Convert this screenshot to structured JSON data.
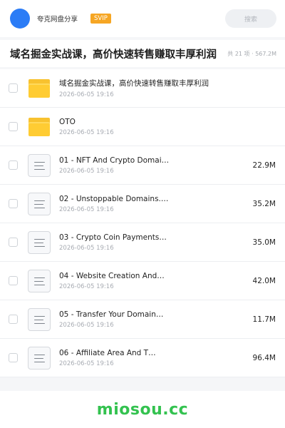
{
  "header": {
    "app_name": "夸克网盘分享",
    "badge": "SVIP",
    "search_label": "搜索",
    "avatar_color": "#2b7cf6",
    "badge_color": "#f6a623"
  },
  "folder": {
    "title": "域名掘金实战课，高价快速转售赚取丰厚利润",
    "summary": "共 21 项 · 567.2M"
  },
  "files": [
    {
      "icon": "folder-icon",
      "name": "域名掘金实战课，高价快速转售赚取丰厚利润",
      "date": "2026-06-05 19:16",
      "size": ""
    },
    {
      "icon": "folder-icon",
      "name": "OTO",
      "date": "2026-06-05 19:16",
      "size": ""
    },
    {
      "icon": "document-icon",
      "name": "01 - NFT And Crypto Domai…",
      "date": "2026-06-05 19:16",
      "size": "22.9M"
    },
    {
      "icon": "document-icon",
      "name": "02 - Unstoppable Domains.…",
      "date": "2026-06-05 19:16",
      "size": "35.2M"
    },
    {
      "icon": "document-icon",
      "name": "03 - Crypto Coin Payments…",
      "date": "2026-06-05 19:16",
      "size": "35.0M"
    },
    {
      "icon": "document-icon",
      "name": "04 - Website Creation And…",
      "date": "2026-06-05 19:16",
      "size": "42.0M"
    },
    {
      "icon": "document-icon",
      "name": "05 - Transfer Your Domain…",
      "date": "2026-06-05 19:16",
      "size": "11.7M"
    },
    {
      "icon": "document-icon",
      "name": "06 - Affiliate Area And T…",
      "date": "2026-06-05 19:16",
      "size": "96.4M"
    }
  ],
  "watermark": "miosou.cc"
}
